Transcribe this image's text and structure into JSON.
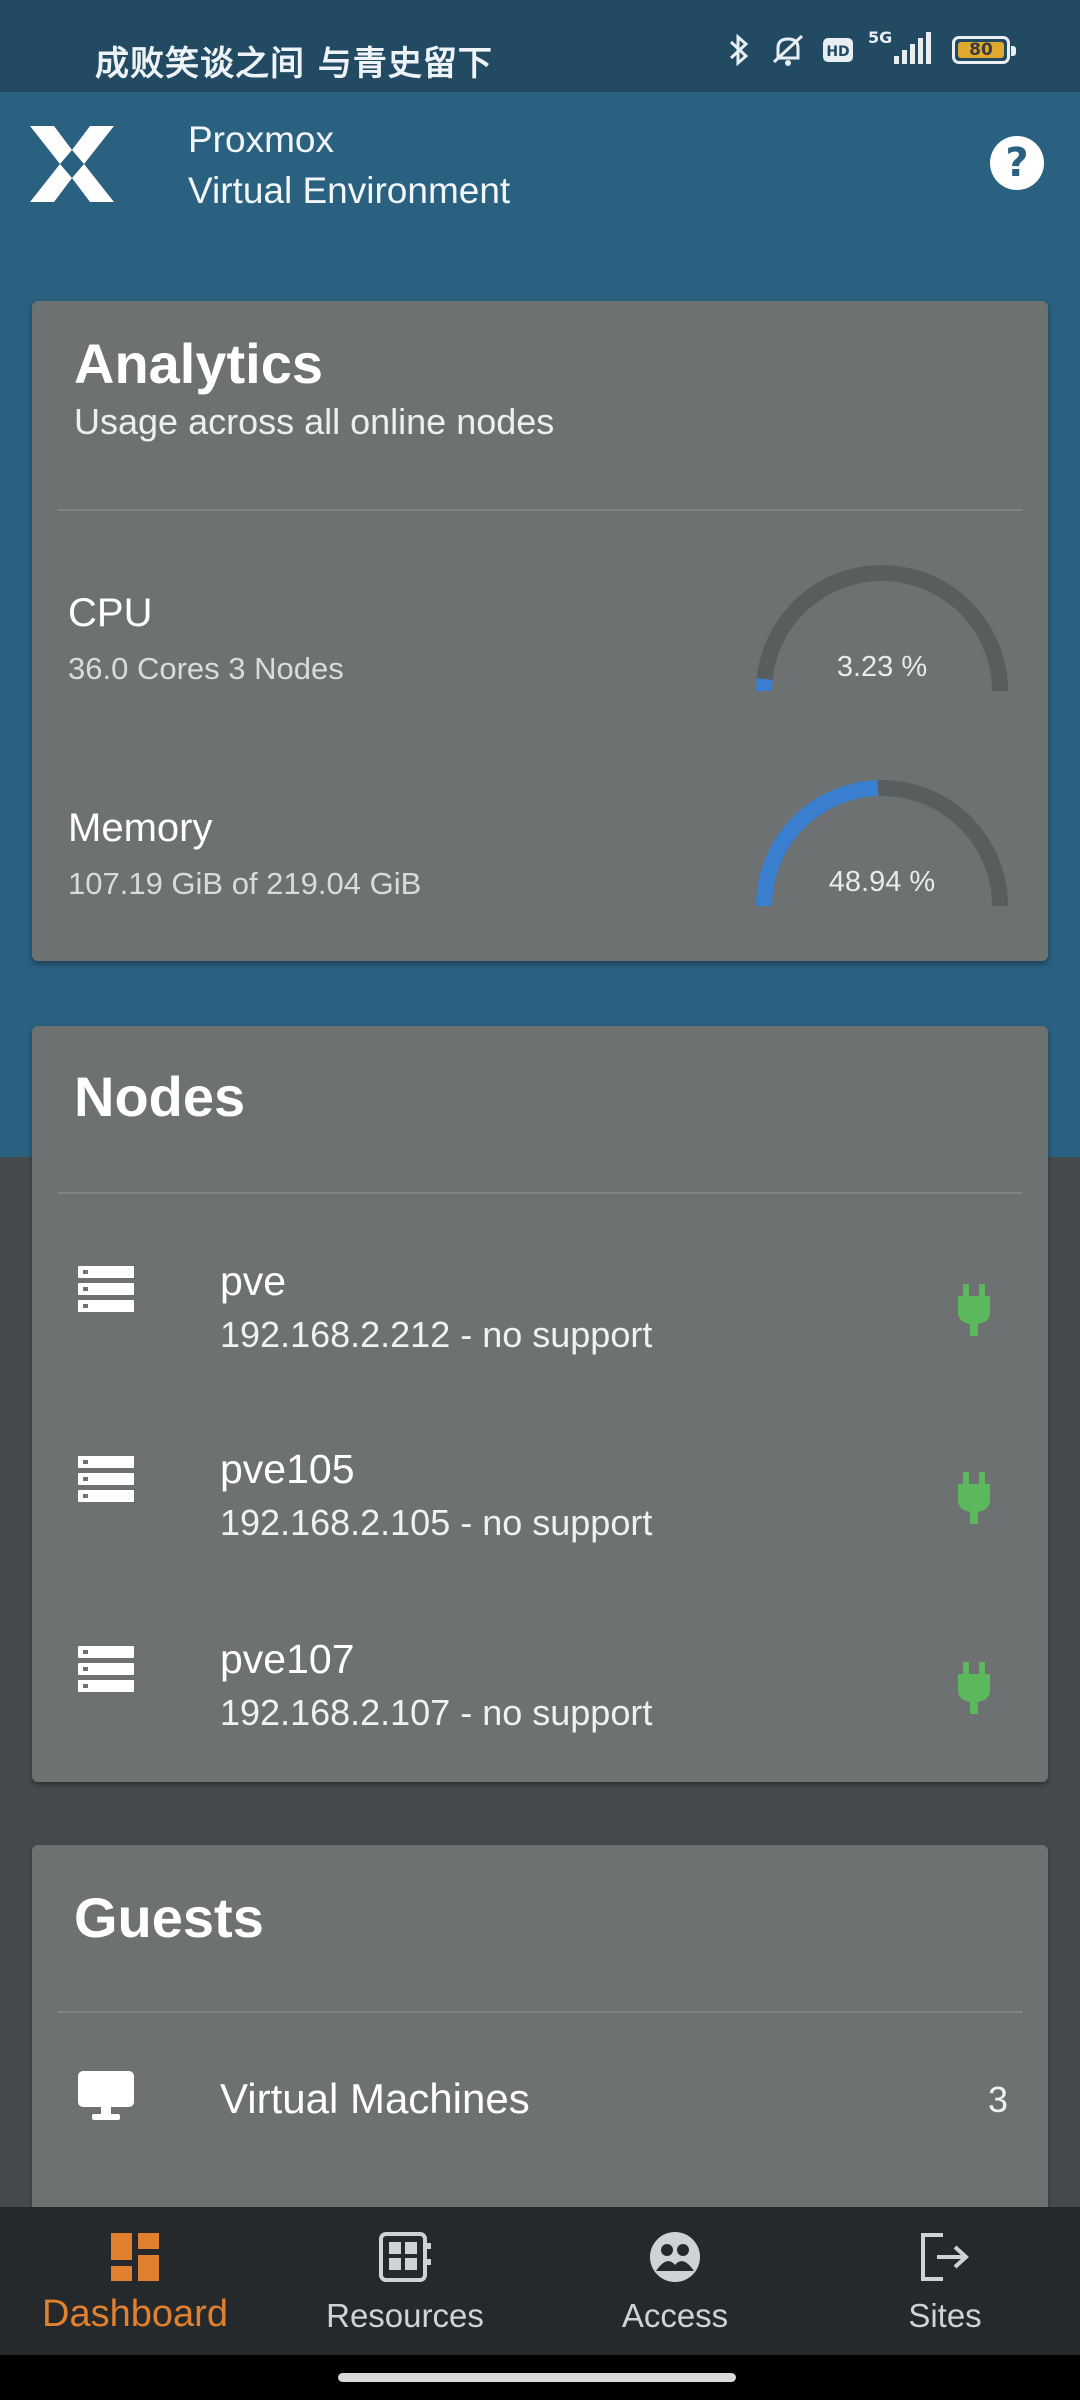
{
  "status_bar": {
    "text": "成败笑谈之间 与青史留下",
    "battery": "80",
    "network": "5G"
  },
  "app": {
    "title_line1": "Proxmox",
    "title_line2": "Virtual Environment",
    "help_label": "?"
  },
  "analytics": {
    "title": "Analytics",
    "subtitle": "Usage across all online nodes",
    "cpu": {
      "name": "CPU",
      "detail": "36.0 Cores 3 Nodes",
      "percent_text": "3.23 %",
      "percent": 3.23
    },
    "memory": {
      "name": "Memory",
      "detail": "107.19 GiB of 219.04 GiB",
      "percent_text": "48.94 %",
      "percent": 48.94
    }
  },
  "nodes": {
    "title": "Nodes",
    "items": [
      {
        "name": "pve",
        "detail": "192.168.2.212 - no support",
        "status": "online"
      },
      {
        "name": "pve105",
        "detail": "192.168.2.105 - no support",
        "status": "online"
      },
      {
        "name": "pve107",
        "detail": "192.168.2.107 - no support",
        "status": "online"
      }
    ]
  },
  "guests": {
    "title": "Guests",
    "items": [
      {
        "name": "Virtual Machines",
        "count": "3"
      }
    ]
  },
  "bottom_nav": {
    "items": [
      {
        "label": "Dashboard",
        "icon": "dashboard-icon",
        "active": true
      },
      {
        "label": "Resources",
        "icon": "resources-icon",
        "active": false
      },
      {
        "label": "Access",
        "icon": "access-icon",
        "active": false
      },
      {
        "label": "Sites",
        "icon": "sites-icon",
        "active": false
      }
    ]
  },
  "colors": {
    "primary": "#2a6180",
    "card": "#6d7171",
    "accent_orange": "#e1812f",
    "gauge_fill": "#3a7fd0",
    "online_green": "#5cb85c"
  }
}
